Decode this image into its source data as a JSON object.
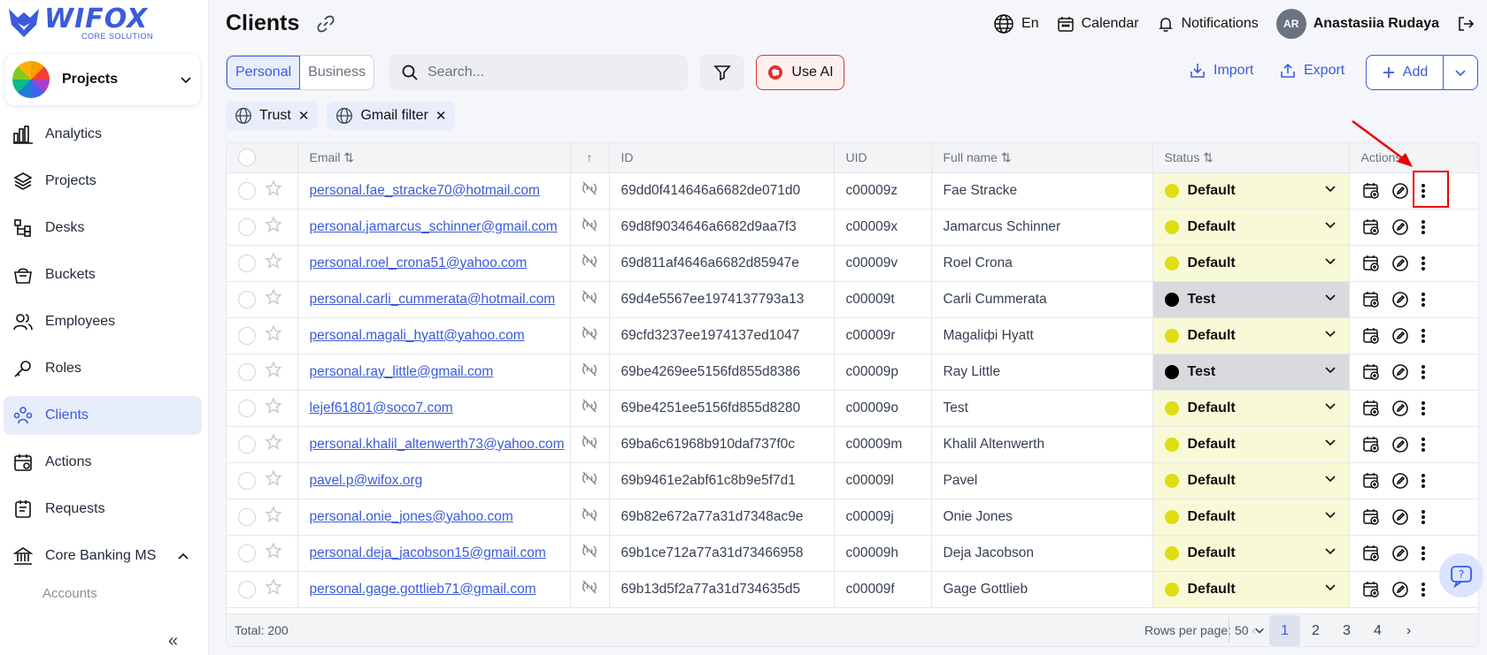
{
  "brand": {
    "name": "WIFOX",
    "sub": "CORE SOLUTION"
  },
  "project_selector": {
    "label": "Projects"
  },
  "nav": [
    {
      "label": "Analytics",
      "icon": "analytics-icon"
    },
    {
      "label": "Projects",
      "icon": "layers-icon"
    },
    {
      "label": "Desks",
      "icon": "desks-icon"
    },
    {
      "label": "Buckets",
      "icon": "bucket-icon"
    },
    {
      "label": "Employees",
      "icon": "users-icon"
    },
    {
      "label": "Roles",
      "icon": "key-icon"
    },
    {
      "label": "Clients",
      "icon": "clients-icon",
      "active": true
    },
    {
      "label": "Actions",
      "icon": "calendar-plus-icon"
    },
    {
      "label": "Requests",
      "icon": "requests-icon"
    },
    {
      "label": "Core Banking MS",
      "icon": "bank-icon",
      "expanded": true
    }
  ],
  "nav_sub": {
    "label": "Accounts"
  },
  "page": {
    "title": "Clients"
  },
  "topbar": {
    "lang": "En",
    "calendar": "Calendar",
    "notifications": "Notifications",
    "avatar_initials": "AR",
    "user_name": "Anastasiia Rudaya"
  },
  "toolbar": {
    "tab_personal": "Personal",
    "tab_business": "Business",
    "search_placeholder": "Search...",
    "use_ai": "Use AI",
    "import": "Import",
    "export": "Export",
    "add": "Add"
  },
  "filters": [
    "Trust",
    "Gmail filter"
  ],
  "table": {
    "headers": {
      "email": "Email",
      "id": "ID",
      "uid": "UID",
      "full_name": "Full name",
      "status": "Status",
      "actions": "Actions"
    },
    "rows": [
      {
        "email": "personal.fae_stracke70@hotmail.com",
        "id": "69dd0f414646a6682de071d0",
        "uid": "c00009z",
        "name": "Fae Stracke",
        "status": "Default"
      },
      {
        "email": "personal.jamarcus_schinner@gmail.com",
        "id": "69d8f9034646a6682d9aa7f3",
        "uid": "c00009x",
        "name": "Jamarcus Schinner",
        "status": "Default"
      },
      {
        "email": "personal.roel_crona51@yahoo.com",
        "id": "69d811af4646a6682d85947e",
        "uid": "c00009v",
        "name": "Roel Crona",
        "status": "Default"
      },
      {
        "email": "personal.carli_cummerata@hotmail.com",
        "id": "69d4e5567ee1974137793a13",
        "uid": "c00009t",
        "name": "Carli Cummerata",
        "status": "Test"
      },
      {
        "email": "personal.magali_hyatt@yahoo.com",
        "id": "69cfd3237ee1974137ed1047",
        "uid": "c00009r",
        "name": "Magaliфі Hyatt",
        "status": "Default"
      },
      {
        "email": "personal.ray_little@gmail.com",
        "id": "69be4269ee5156fd855d8386",
        "uid": "c00009p",
        "name": "Ray Little",
        "status": "Test"
      },
      {
        "email": "lejef61801@soco7.com",
        "id": "69be4251ee5156fd855d8280",
        "uid": "c00009o",
        "name": "Test",
        "status": "Default"
      },
      {
        "email": "personal.khalil_altenwerth73@yahoo.com",
        "id": "69ba6c61968b910daf737f0c",
        "uid": "c00009m",
        "name": "Khalil Altenwerth",
        "status": "Default"
      },
      {
        "email": "pavel.p@wifox.org",
        "id": "69b9461e2abf61c8b9e5f7d1",
        "uid": "c00009l",
        "name": "Pavel",
        "status": "Default"
      },
      {
        "email": "personal.onie_jones@yahoo.com",
        "id": "69b82e672a77a31d7348ac9e",
        "uid": "c00009j",
        "name": "Onie Jones",
        "status": "Default"
      },
      {
        "email": "personal.deja_jacobson15@gmail.com",
        "id": "69b1ce712a77a31d73466958",
        "uid": "c00009h",
        "name": "Deja Jacobson",
        "status": "Default"
      },
      {
        "email": "personal.gage.gottlieb71@gmail.com",
        "id": "69b13d5f2a77a31d734635d5",
        "uid": "c00009f",
        "name": "Gage Gottlieb",
        "status": "Default"
      }
    ]
  },
  "status_colors": {
    "Default": {
      "dot": "#dede10",
      "bg": "#f7f9d7"
    },
    "Test": {
      "dot": "#000000",
      "bg": "#d9dadd"
    }
  },
  "footer": {
    "total": "Total: 200",
    "rows_per_page": "Rows per page: 50",
    "pages": [
      "1",
      "2",
      "3",
      "4"
    ],
    "current_page": "1"
  }
}
